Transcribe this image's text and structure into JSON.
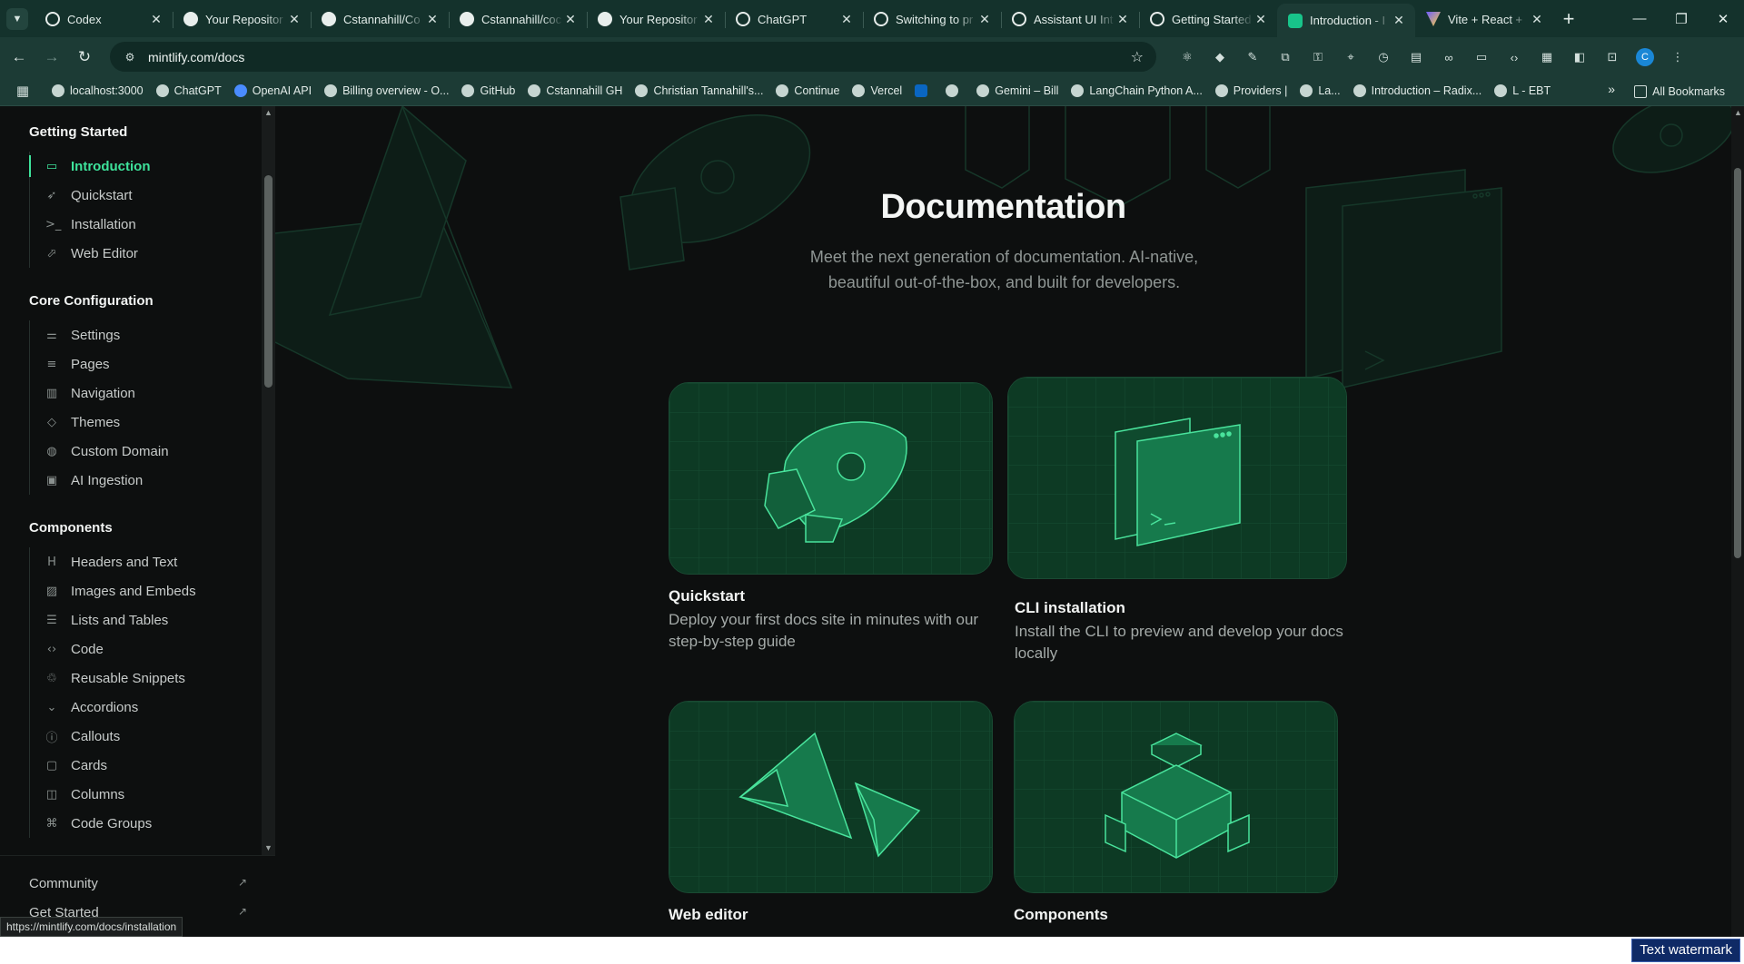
{
  "browser": {
    "tabs": [
      {
        "title": "Codex",
        "icon": "openai-icon"
      },
      {
        "title": "Your Repositor",
        "icon": "github-icon"
      },
      {
        "title": "Cstannahill/Co",
        "icon": "github-icon"
      },
      {
        "title": "Cstannahill/coc",
        "icon": "github-icon"
      },
      {
        "title": "Your Repositor",
        "icon": "github-icon"
      },
      {
        "title": "ChatGPT",
        "icon": "openai-icon"
      },
      {
        "title": "Switching to pr",
        "icon": "openai-icon"
      },
      {
        "title": "Assistant UI Int",
        "icon": "openai-icon"
      },
      {
        "title": "Getting Started",
        "icon": "claude-icon"
      },
      {
        "title": "Introduction - I",
        "icon": "mintlify-icon",
        "active": true
      },
      {
        "title": "Vite + React +",
        "icon": "vite-icon"
      }
    ],
    "url": "mintlify.com/docs",
    "profile_initial": "C",
    "bookmarks": [
      {
        "label": "localhost:3000"
      },
      {
        "label": "ChatGPT"
      },
      {
        "label": "OpenAI API"
      },
      {
        "label": "Billing overview - O..."
      },
      {
        "label": "GitHub"
      },
      {
        "label": "Cstannahill GH"
      },
      {
        "label": "Christian Tannahill's..."
      },
      {
        "label": "Continue"
      },
      {
        "label": "Vercel"
      },
      {
        "label": ""
      },
      {
        "label": ""
      },
      {
        "label": "Gemini – Bill"
      },
      {
        "label": "LangChain Python A..."
      },
      {
        "label": "Providers | "
      },
      {
        "label": "La..."
      },
      {
        "label": "Introduction – Radix..."
      },
      {
        "label": "L - EBT"
      }
    ],
    "all_bookmarks": "All Bookmarks"
  },
  "sidebar": {
    "groups": [
      {
        "title": "Getting Started",
        "items": [
          {
            "label": "Introduction",
            "icon": "book-open-icon",
            "glyph": "▭",
            "active": true
          },
          {
            "label": "Quickstart",
            "icon": "rocket-icon",
            "glyph": "➶"
          },
          {
            "label": "Installation",
            "icon": "terminal-icon",
            "glyph": ">_"
          },
          {
            "label": "Web Editor",
            "icon": "cursor-icon",
            "glyph": "⬀"
          }
        ]
      },
      {
        "title": "Core Configuration",
        "items": [
          {
            "label": "Settings",
            "icon": "sliders-icon",
            "glyph": "⚌"
          },
          {
            "label": "Pages",
            "icon": "list-icon",
            "glyph": "≡"
          },
          {
            "label": "Navigation",
            "icon": "map-icon",
            "glyph": "▥"
          },
          {
            "label": "Themes",
            "icon": "paint-bucket-icon",
            "glyph": "◇"
          },
          {
            "label": "Custom Domain",
            "icon": "globe-icon",
            "glyph": "◍"
          },
          {
            "label": "AI Ingestion",
            "icon": "bot-icon",
            "glyph": "▣"
          }
        ]
      },
      {
        "title": "Components",
        "items": [
          {
            "label": "Headers and Text",
            "icon": "heading-icon",
            "glyph": "H"
          },
          {
            "label": "Images and Embeds",
            "icon": "image-icon",
            "glyph": "▨"
          },
          {
            "label": "Lists and Tables",
            "icon": "list-bullets-icon",
            "glyph": "☰"
          },
          {
            "label": "Code",
            "icon": "code-icon",
            "glyph": "‹›"
          },
          {
            "label": "Reusable Snippets",
            "icon": "recycle-icon",
            "glyph": "♲"
          },
          {
            "label": "Accordions",
            "icon": "chevron-down-icon",
            "glyph": "⌄"
          },
          {
            "label": "Callouts",
            "icon": "info-icon",
            "glyph": "ⓘ"
          },
          {
            "label": "Cards",
            "icon": "card-icon",
            "glyph": "▢"
          },
          {
            "label": "Columns",
            "icon": "columns-icon",
            "glyph": "◫"
          },
          {
            "label": "Code Groups",
            "icon": "code-group-icon",
            "glyph": "⌘"
          }
        ]
      }
    ],
    "links": [
      {
        "label": "Community"
      },
      {
        "label": "Get Started"
      }
    ]
  },
  "hero": {
    "title": "Documentation",
    "subtitle": "Meet the next generation of documentation. AI-native, beautiful out-of-the-box, and built for developers."
  },
  "cards": [
    {
      "title": "Quickstart",
      "description": "Deploy your first docs site in minutes with our step-by-step guide",
      "illustration": "rocket-illustration"
    },
    {
      "title": "CLI installation",
      "description": "Install the CLI to preview and develop your docs locally",
      "illustration": "terminal-window-illustration"
    },
    {
      "title": "Web editor",
      "description": "",
      "illustration": "paper-planes-illustration"
    },
    {
      "title": "Components",
      "description": "",
      "illustration": "blocks-illustration"
    }
  ],
  "status_url": "https://mintlify.com/docs/installation",
  "watermark": "Text watermark",
  "colors": {
    "accent": "#3ee39b",
    "page_bg": "#0d0f0f",
    "browser_frame": "#14322c",
    "card_bg": "#0f3a27"
  }
}
